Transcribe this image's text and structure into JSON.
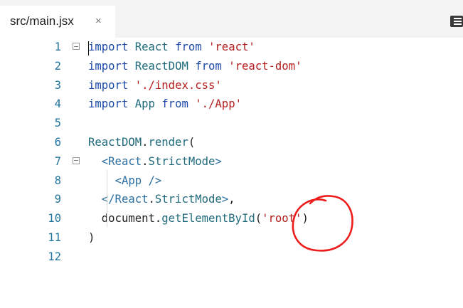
{
  "tab": {
    "title": "src/main.jsx",
    "close": "×"
  },
  "icons": {
    "tab_close": "close-icon",
    "menu": "menu-icon",
    "fold": "fold-toggle-icon"
  },
  "colors": {
    "highlight": "#ffff1a",
    "annotation": "#ee1d1d",
    "keyword": "#1d4aa8",
    "string": "#b31d1d",
    "line_number": "#23759e"
  },
  "lines": [
    {
      "num": "1",
      "t": [
        [
          "import",
          "kw"
        ],
        [
          " ",
          "pl"
        ],
        [
          "React",
          "id"
        ],
        [
          " ",
          "pl"
        ],
        [
          "from",
          "kw"
        ],
        [
          " ",
          "pl"
        ],
        [
          "'react'",
          "str"
        ]
      ]
    },
    {
      "num": "2",
      "t": [
        [
          "import",
          "kw"
        ],
        [
          " ",
          "pl"
        ],
        [
          "ReactDOM",
          "id"
        ],
        [
          " ",
          "pl"
        ],
        [
          "from",
          "kw"
        ],
        [
          " ",
          "pl"
        ],
        [
          "'react-dom'",
          "str"
        ]
      ]
    },
    {
      "num": "3",
      "t": [
        [
          "import",
          "kw"
        ],
        [
          " ",
          "pl"
        ],
        [
          "'./index.css'",
          "str"
        ]
      ]
    },
    {
      "num": "4",
      "t": [
        [
          "import",
          "kw"
        ],
        [
          " ",
          "pl"
        ],
        [
          "App",
          "id"
        ],
        [
          " ",
          "pl"
        ],
        [
          "from",
          "kw"
        ],
        [
          " ",
          "pl"
        ],
        [
          "'./App'",
          "str"
        ]
      ]
    },
    {
      "num": "5",
      "t": []
    },
    {
      "num": "6",
      "t": [
        [
          "ReactDOM",
          "id"
        ],
        [
          ".",
          "pl"
        ],
        [
          "render",
          "id"
        ],
        [
          "(",
          "pl"
        ]
      ]
    },
    {
      "num": "7",
      "t": [
        [
          "  ",
          "pl"
        ],
        [
          "<React",
          "tag"
        ],
        [
          ".",
          "pl"
        ],
        [
          "StrictMode",
          "id"
        ],
        [
          ">",
          "tag"
        ]
      ]
    },
    {
      "num": "8",
      "t": [
        [
          "    ",
          "pl"
        ],
        [
          "<App />",
          "tag"
        ]
      ]
    },
    {
      "num": "9",
      "t": [
        [
          "  ",
          "pl"
        ],
        [
          "</React",
          "tag"
        ],
        [
          ".",
          "pl"
        ],
        [
          "StrictMode",
          "id"
        ],
        [
          ">",
          "tag"
        ],
        [
          ",",
          "pl"
        ]
      ]
    },
    {
      "num": "10",
      "t": [
        [
          "  ",
          "pl"
        ],
        [
          "document",
          "pl"
        ],
        [
          ".",
          "pl"
        ],
        [
          "getElementById",
          "id"
        ],
        [
          "(",
          "pl"
        ],
        [
          "'root'",
          "str"
        ],
        [
          ")",
          "pl"
        ]
      ]
    },
    {
      "num": "11",
      "t": [
        [
          ")",
          "pl"
        ]
      ]
    },
    {
      "num": "12",
      "t": []
    }
  ]
}
